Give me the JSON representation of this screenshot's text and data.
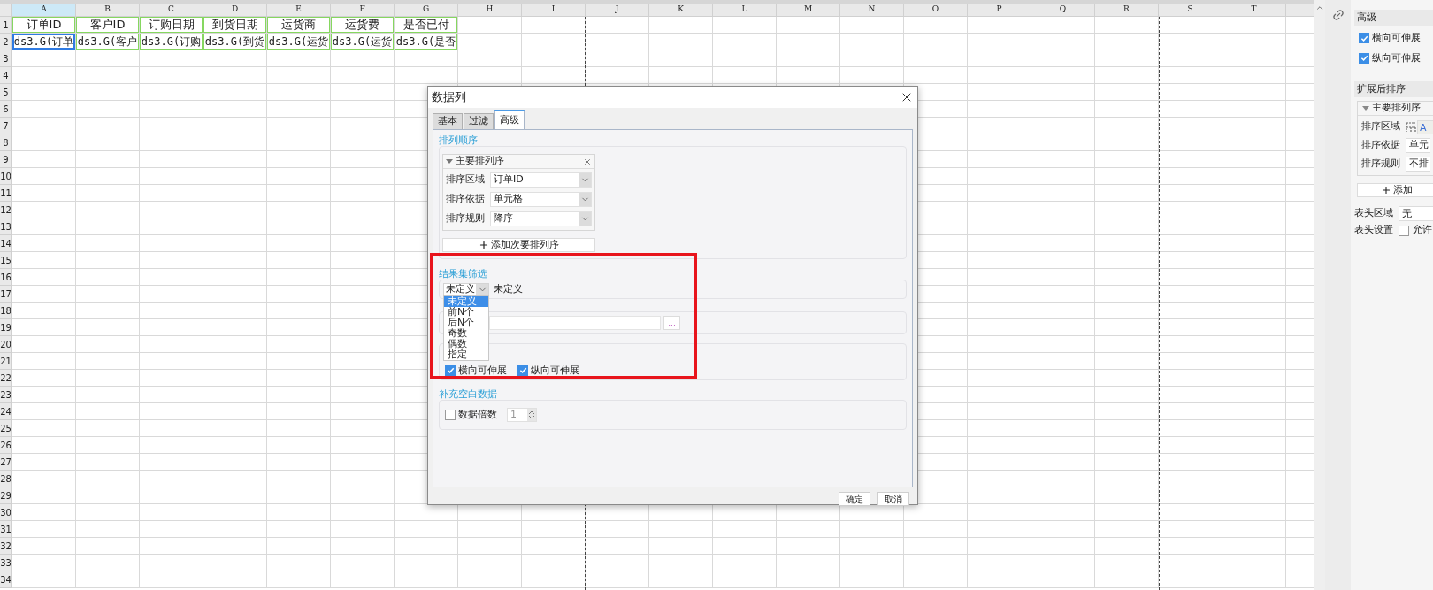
{
  "sheet": {
    "columns": [
      "A",
      "B",
      "C",
      "D",
      "E",
      "F",
      "G",
      "H",
      "I",
      "J",
      "K",
      "L",
      "M",
      "N",
      "O",
      "P",
      "Q",
      "R",
      "S",
      "T"
    ],
    "row_numbers": [
      "1",
      "2",
      "3",
      "4",
      "5",
      "6",
      "7",
      "8",
      "9",
      "10",
      "11",
      "12",
      "13",
      "14",
      "15",
      "16",
      "17",
      "18",
      "19",
      "20",
      "21",
      "22",
      "23",
      "24",
      "25",
      "26",
      "27",
      "28",
      "29",
      "30",
      "31",
      "32",
      "33",
      "34"
    ],
    "header_cells": [
      "订单ID",
      "客户ID",
      "订购日期",
      "到货日期",
      "运货商",
      "运货费",
      "是否已付"
    ],
    "data_cells": [
      {
        "text": "ds3.G(订单",
        "selected": true
      },
      {
        "text": "ds3.G(客户",
        "selected": false
      },
      {
        "text": "ds3.G(订购",
        "selected": false
      },
      {
        "text": "ds3.G(到货",
        "selected": false
      },
      {
        "text": "ds3.G(运货",
        "selected": false
      },
      {
        "text": "ds3.G(运货",
        "selected": false
      },
      {
        "text": "ds3.G(是否",
        "selected": false
      }
    ]
  },
  "dialog": {
    "title": "数据列",
    "tabs": [
      {
        "label": "基本",
        "selected": false
      },
      {
        "label": "过滤",
        "selected": false
      },
      {
        "label": "高级",
        "selected": true
      }
    ],
    "sort_section": {
      "title": "排列顺序",
      "group_title": "主要排列序",
      "rows": [
        {
          "label": "排序区域",
          "value": "订单ID"
        },
        {
          "label": "排序依据",
          "value": "单元格"
        },
        {
          "label": "排序规则",
          "value": "降序"
        }
      ],
      "add_button": "添加次要排列序"
    },
    "filter_section": {
      "title": "结果集筛选",
      "select_value": "未定义",
      "description": "未定义",
      "dropdown_options": [
        {
          "label": "未定义",
          "selected": true
        },
        {
          "label": "前N个",
          "selected": false
        },
        {
          "label": "后N个",
          "selected": false
        },
        {
          "label": "奇数",
          "selected": false
        },
        {
          "label": "偶数",
          "selected": false
        },
        {
          "label": "指定",
          "selected": false
        }
      ]
    },
    "formula_section": {
      "ellipsis_button": "..."
    },
    "expand_section": {
      "checkboxes": [
        {
          "label": "横向可伸展",
          "checked": true
        },
        {
          "label": "纵向可伸展",
          "checked": true
        }
      ]
    },
    "fill_section": {
      "title": "补充空白数据",
      "checkbox": {
        "label": "数据倍数",
        "checked": false
      },
      "multiplier": "1"
    },
    "buttons": [
      "确定",
      "取消"
    ]
  },
  "side_panel": {
    "advanced": {
      "title": "高级",
      "checkboxes": [
        {
          "label": "横向可伸展",
          "checked": true
        },
        {
          "label": "纵向可伸展",
          "checked": true
        }
      ]
    },
    "sort_after_expand": {
      "title": "扩展后排序",
      "group_title": "主要排列序",
      "rows": [
        {
          "label": "排序区域",
          "value": "A",
          "kind": "area"
        },
        {
          "label": "排序依据",
          "value": "单元",
          "kind": "select"
        },
        {
          "label": "排序规则",
          "value": "不排",
          "kind": "select"
        }
      ],
      "add_button": "添加"
    },
    "header_area": {
      "label": "表头区域",
      "value": "无"
    },
    "header_setting": {
      "label": "表头设置",
      "checkbox_label": "允许",
      "checked": false
    }
  }
}
